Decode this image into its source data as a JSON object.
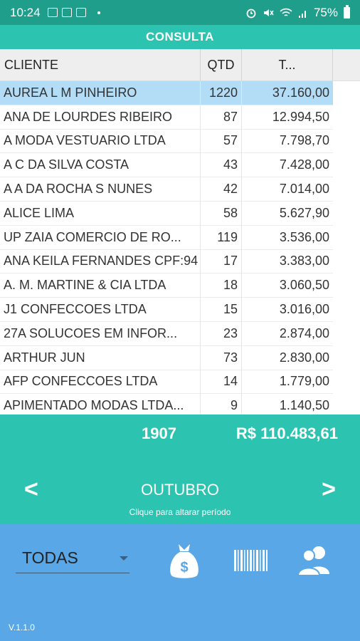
{
  "status_bar": {
    "time": "10:24",
    "battery": "75%"
  },
  "title": "CONSULTA",
  "table": {
    "headers": [
      "CLIENTE",
      "QTD",
      "T..."
    ],
    "rows": [
      {
        "cliente": "AUREA L M PINHEIRO",
        "qtd": "1220",
        "total": "37.160,00"
      },
      {
        "cliente": "ANA DE LOURDES RIBEIRO",
        "qtd": "87",
        "total": "12.994,50"
      },
      {
        "cliente": "A MODA VESTUARIO LTDA",
        "qtd": "57",
        "total": "7.798,70"
      },
      {
        "cliente": "A C DA SILVA COSTA",
        "qtd": "43",
        "total": "7.428,00"
      },
      {
        "cliente": "A A DA ROCHA S NUNES",
        "qtd": "42",
        "total": "7.014,00"
      },
      {
        "cliente": "ALICE LIMA",
        "qtd": "58",
        "total": "5.627,90"
      },
      {
        "cliente": "UP ZAIA COMERCIO DE RO...",
        "qtd": "119",
        "total": "3.536,00"
      },
      {
        "cliente": "ANA KEILA FERNANDES CPF:94",
        "qtd": "17",
        "total": "3.383,00"
      },
      {
        "cliente": "A. M. MARTINE & CIA LTDA",
        "qtd": "18",
        "total": "3.060,50"
      },
      {
        "cliente": "J1 CONFECCOES LTDA",
        "qtd": "15",
        "total": "3.016,00"
      },
      {
        "cliente": "27A SOLUCOES EM INFOR...",
        "qtd": "23",
        "total": "2.874,00"
      },
      {
        "cliente": "ARTHUR JUN",
        "qtd": "73",
        "total": "2.830,00"
      },
      {
        "cliente": "AFP CONFECCOES LTDA",
        "qtd": "14",
        "total": "1.779,00"
      },
      {
        "cliente": "APIMENTADO MODAS LTDA...",
        "qtd": "9",
        "total": "1.140,50"
      }
    ]
  },
  "totals": {
    "qtd": "1907",
    "value": "R$ 110.483,61"
  },
  "period": {
    "prev": "<",
    "next": ">",
    "month": "OUTUBRO",
    "hint": "Clique para altarar período"
  },
  "filter": {
    "selected": "TODAS"
  },
  "version": "V.1.1.0",
  "colors": {
    "status_bar": "#1f9e8c",
    "accent": "#2cc4b0",
    "footer": "#59a7e6",
    "selected_row": "#b3dcf6"
  },
  "icons": [
    "money-bag-icon",
    "barcode-icon",
    "users-icon"
  ]
}
